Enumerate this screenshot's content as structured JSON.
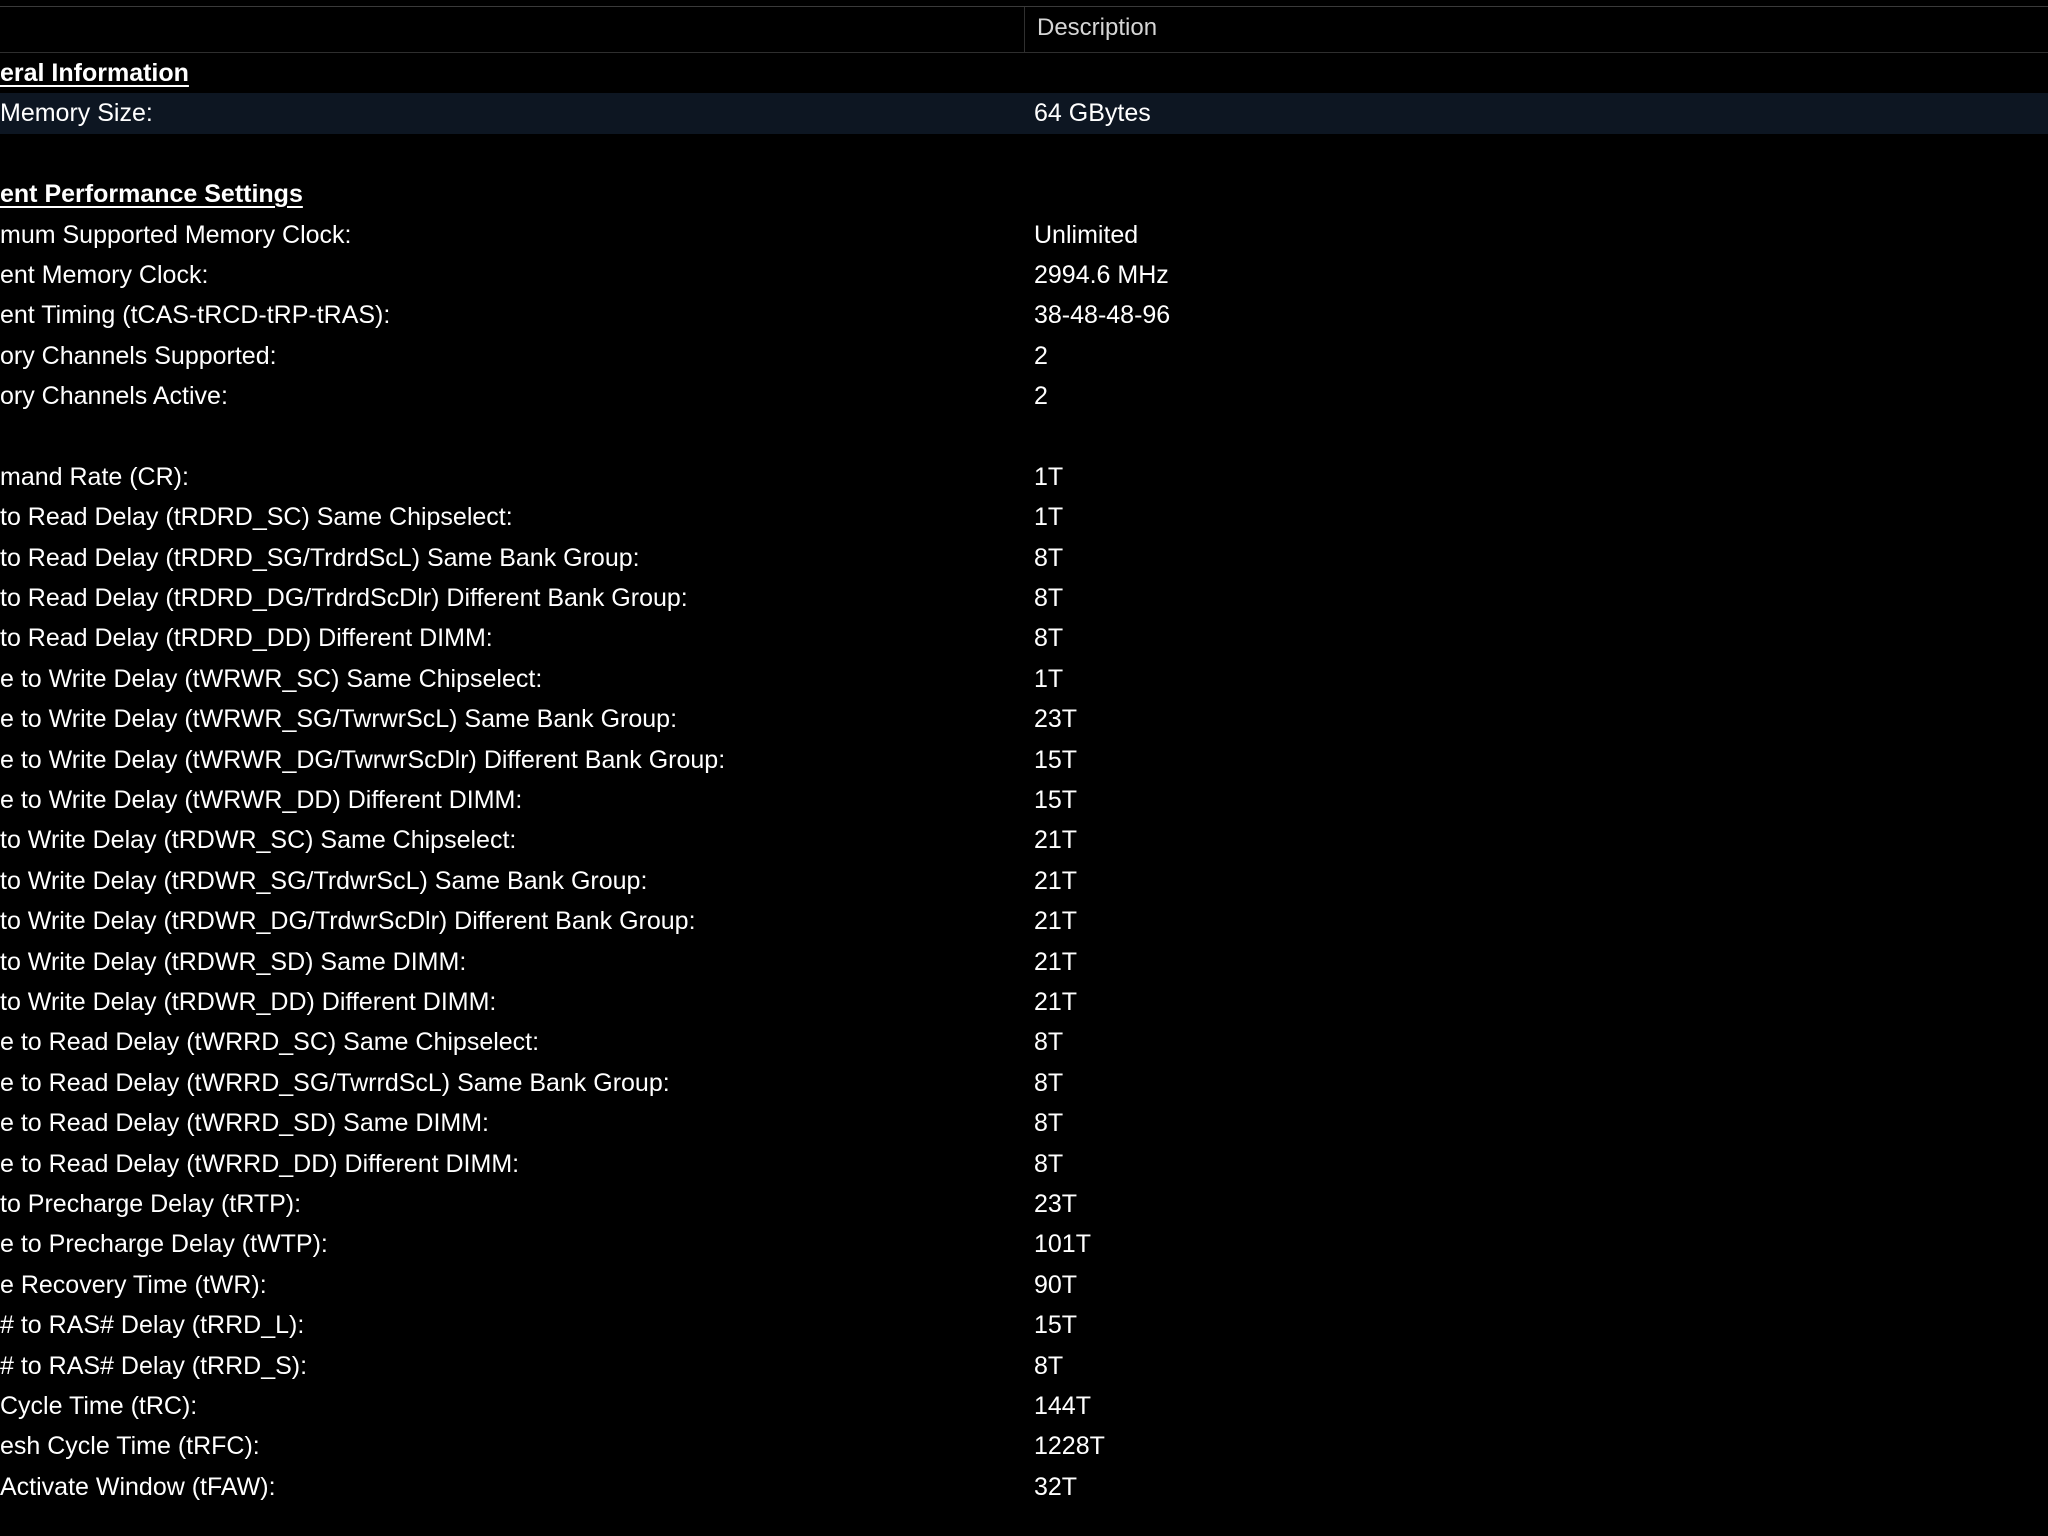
{
  "header": {
    "description_label": "Description"
  },
  "rows": [
    {
      "type": "section",
      "field": "eral Information",
      "value": ""
    },
    {
      "type": "item",
      "field": " Memory Size:",
      "value": "64 GBytes",
      "selected": true
    },
    {
      "type": "blank",
      "field": "",
      "value": ""
    },
    {
      "type": "section",
      "field": "ent Performance Settings",
      "value": ""
    },
    {
      "type": "item",
      "field": "mum Supported Memory Clock:",
      "value": "Unlimited"
    },
    {
      "type": "item",
      "field": "ent Memory Clock:",
      "value": "2994.6 MHz"
    },
    {
      "type": "item",
      "field": "ent Timing (tCAS-tRCD-tRP-tRAS):",
      "value": "38-48-48-96"
    },
    {
      "type": "item",
      "field": "ory Channels Supported:",
      "value": "2"
    },
    {
      "type": "item",
      "field": "ory Channels Active:",
      "value": "2"
    },
    {
      "type": "blank",
      "field": "",
      "value": ""
    },
    {
      "type": "item",
      "field": "mand Rate (CR):",
      "value": "1T"
    },
    {
      "type": "item",
      "field": " to Read Delay (tRDRD_SC) Same Chipselect:",
      "value": "1T"
    },
    {
      "type": "item",
      "field": " to Read Delay (tRDRD_SG/TrdrdScL) Same Bank Group:",
      "value": "8T"
    },
    {
      "type": "item",
      "field": " to Read Delay (tRDRD_DG/TrdrdScDlr) Different Bank Group:",
      "value": "8T"
    },
    {
      "type": "item",
      "field": " to Read Delay (tRDRD_DD) Different DIMM:",
      "value": "8T"
    },
    {
      "type": "item",
      "field": "e to Write Delay (tWRWR_SC) Same Chipselect:",
      "value": "1T"
    },
    {
      "type": "item",
      "field": "e to Write Delay (tWRWR_SG/TwrwrScL) Same Bank Group:",
      "value": "23T"
    },
    {
      "type": "item",
      "field": "e to Write Delay (tWRWR_DG/TwrwrScDlr) Different Bank Group:",
      "value": "15T"
    },
    {
      "type": "item",
      "field": "e to Write Delay (tWRWR_DD) Different DIMM:",
      "value": "15T"
    },
    {
      "type": "item",
      "field": " to Write Delay (tRDWR_SC) Same Chipselect:",
      "value": "21T"
    },
    {
      "type": "item",
      "field": " to Write Delay (tRDWR_SG/TrdwrScL) Same Bank Group:",
      "value": "21T"
    },
    {
      "type": "item",
      "field": " to Write Delay (tRDWR_DG/TrdwrScDlr) Different Bank Group:",
      "value": "21T"
    },
    {
      "type": "item",
      "field": " to Write Delay (tRDWR_SD) Same DIMM:",
      "value": "21T"
    },
    {
      "type": "item",
      "field": " to Write Delay (tRDWR_DD) Different DIMM:",
      "value": "21T"
    },
    {
      "type": "item",
      "field": "e to Read Delay (tWRRD_SC) Same Chipselect:",
      "value": "8T"
    },
    {
      "type": "item",
      "field": "e to Read Delay (tWRRD_SG/TwrrdScL) Same Bank Group:",
      "value": "8T"
    },
    {
      "type": "item",
      "field": "e to Read Delay (tWRRD_SD) Same DIMM:",
      "value": "8T"
    },
    {
      "type": "item",
      "field": "e to Read Delay (tWRRD_DD) Different DIMM:",
      "value": "8T"
    },
    {
      "type": "item",
      "field": " to Precharge Delay (tRTP):",
      "value": "23T"
    },
    {
      "type": "item",
      "field": "e to Precharge Delay (tWTP):",
      "value": "101T"
    },
    {
      "type": "item",
      "field": "e Recovery Time (tWR):",
      "value": "90T"
    },
    {
      "type": "item",
      "field": "# to RAS# Delay (tRRD_L):",
      "value": "15T"
    },
    {
      "type": "item",
      "field": "# to RAS# Delay (tRRD_S):",
      "value": "8T"
    },
    {
      "type": "item",
      "field": "Cycle Time (tRC):",
      "value": "144T"
    },
    {
      "type": "item",
      "field": "esh Cycle Time (tRFC):",
      "value": "1228T"
    },
    {
      "type": "item",
      "field": " Activate Window (tFAW):",
      "value": "32T"
    }
  ]
}
